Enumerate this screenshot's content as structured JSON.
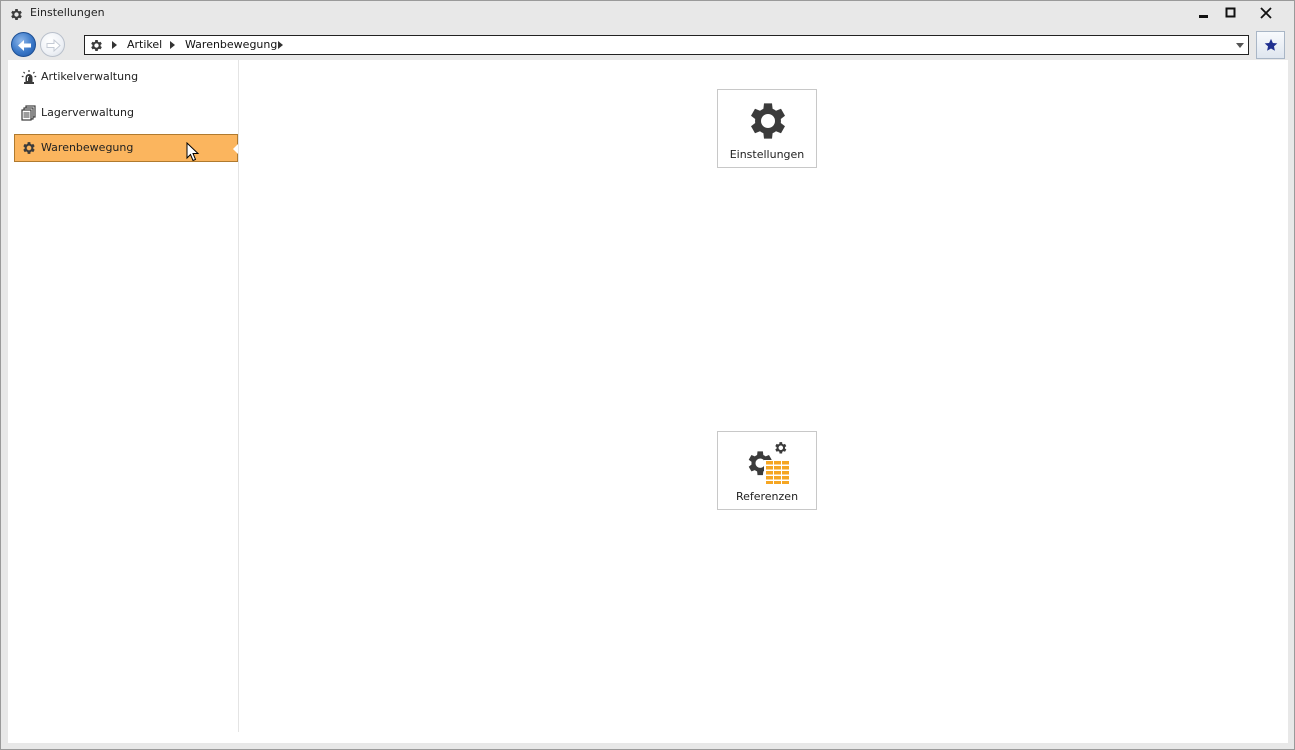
{
  "window": {
    "title": "Einstellungen"
  },
  "breadcrumb": {
    "items": [
      "Artikel",
      "Warenbewegung"
    ]
  },
  "sidebar": {
    "items": [
      {
        "label": "Artikelverwaltung",
        "icon": "siren-icon"
      },
      {
        "label": "Lagerverwaltung",
        "icon": "document-stack-icon"
      },
      {
        "label": "Warenbewegung",
        "icon": "gear-icon",
        "selected": true
      }
    ]
  },
  "tiles": [
    {
      "label": "Einstellungen",
      "icon": "gear-icon"
    },
    {
      "label": "Referenzen",
      "icon": "gears-table-icon"
    }
  ],
  "colors": {
    "accent": "#fbb55e",
    "icon_dark": "#3b3b3b",
    "icon_orange": "#f5a623",
    "favorite_star": "#1f2f8f"
  }
}
